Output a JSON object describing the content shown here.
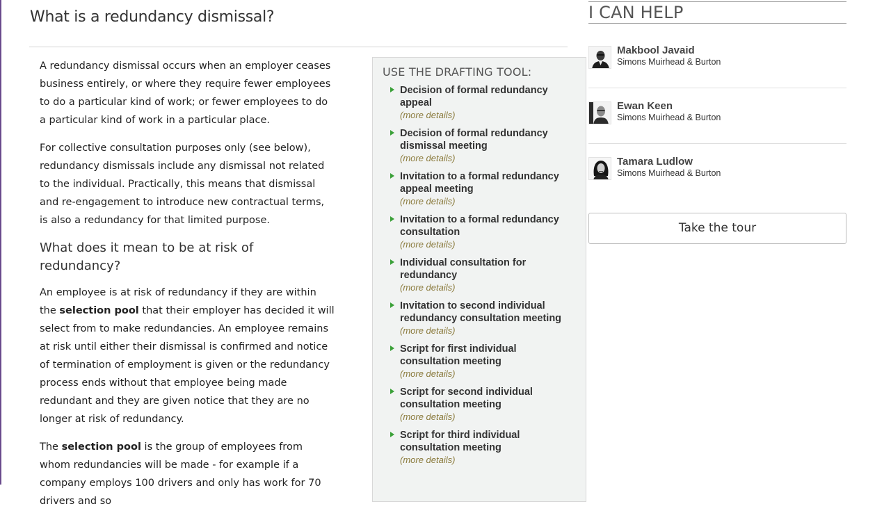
{
  "article": {
    "title": "What is a redundancy dismissal?",
    "para1": "A redundancy dismissal occurs when an employer ceases business entirely, or where they require  fewer employees to do a particular kind of work; or fewer employees to do a particular kind of work in a particular place.",
    "para2": "For collective consultation purposes only (see below), redundancy dismissals include any dismissal not related to the individual. Practically, this means that dismissal and re-engagement to introduce new contractual terms, is also a redundancy for that limited purpose.",
    "subheading": "What does it mean to be at risk of redundancy?",
    "para3": {
      "before": "An employee is at risk of redundancy if they are within the ",
      "bold": "selection pool",
      "after": " that their employer has decided it will select from to make redundancies. An employee  remains at risk until either their dismissal is confirmed and notice of termination of employment is given or the redundancy process ends without that employee being made redundant and they are given notice that they are no longer at risk of redundancy."
    },
    "para4": {
      "before": "The ",
      "bold": "selection pool",
      "after": " is the group of employees from whom redundancies will be made - for example if a company employs 100 drivers and only has work for 70 drivers and so"
    }
  },
  "drafting_tool": {
    "heading": "USE THE DRAFTING TOOL:",
    "items": [
      {
        "title": "Decision of formal redundancy appeal",
        "more": "(more details)"
      },
      {
        "title": "Decision of formal redundancy dismissal meeting",
        "more": "(more details)"
      },
      {
        "title": "Invitation to a formal redundancy appeal meeting",
        "more": "(more details)"
      },
      {
        "title": "Invitation to a formal redundancy consultation",
        "more": "(more details)"
      },
      {
        "title": "Individual consultation for redundancy",
        "more": "(more details)"
      },
      {
        "title": "Invitation to second individual redundancy consultation meeting",
        "more": "(more details)"
      },
      {
        "title": "Script for first individual consultation meeting",
        "more": "(more details)"
      },
      {
        "title": "Script for second individual consultation meeting",
        "more": "(more details)"
      },
      {
        "title": "Script for third individual consultation meeting",
        "more": "(more details)"
      }
    ]
  },
  "sidebar": {
    "heading": "I CAN HELP",
    "experts": [
      {
        "name": "Makbool Javaid",
        "firm": "Simons Muirhead & Burton"
      },
      {
        "name": "Ewan Keen",
        "firm": "Simons Muirhead & Burton"
      },
      {
        "name": "Tamara Ludlow",
        "firm": "Simons Muirhead & Burton"
      }
    ],
    "tour_button": "Take the tour"
  },
  "colors": {
    "arrow": "#3aa038",
    "more_details": "#8a7a3c",
    "tool_box_bg": "#f1f3f2"
  }
}
